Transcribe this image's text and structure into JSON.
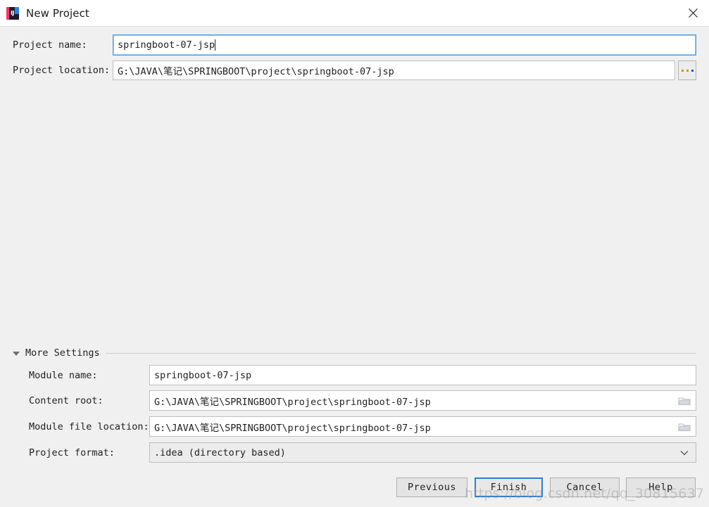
{
  "window": {
    "title": "New Project",
    "app_icon": "intellij-idea-icon",
    "icon_text": "IJ",
    "close_label": "✕"
  },
  "form": {
    "project_name": {
      "label": "Project name:",
      "value": "springboot-07-jsp",
      "focused": true
    },
    "project_location": {
      "label": "Project location:",
      "value": "G:\\JAVA\\笔记\\SPRINGBOOT\\project\\springboot-07-jsp",
      "browse_button": "..."
    }
  },
  "more_settings": {
    "label": "More Settings",
    "expanded": true,
    "module_name": {
      "label": "Module name:",
      "value": "springboot-07-jsp"
    },
    "content_root": {
      "label": "Content root:",
      "value": "G:\\JAVA\\笔记\\SPRINGBOOT\\project\\springboot-07-jsp"
    },
    "module_file_location": {
      "label": "Module file location:",
      "value": "G:\\JAVA\\笔记\\SPRINGBOOT\\project\\springboot-07-jsp"
    },
    "project_format": {
      "label": "Project format:",
      "value": ".idea (directory based)"
    }
  },
  "buttons": {
    "previous": "Previous",
    "finish": "Finish",
    "cancel": "Cancel",
    "help": "Help"
  },
  "watermark": "https://blog.csdn.net/qq_30815637",
  "colors": {
    "accent": "#2d7dd2",
    "focus_border": "#4a9de0",
    "body_bg": "#f0f0f0",
    "titlebar_bg": "#ffffff"
  }
}
